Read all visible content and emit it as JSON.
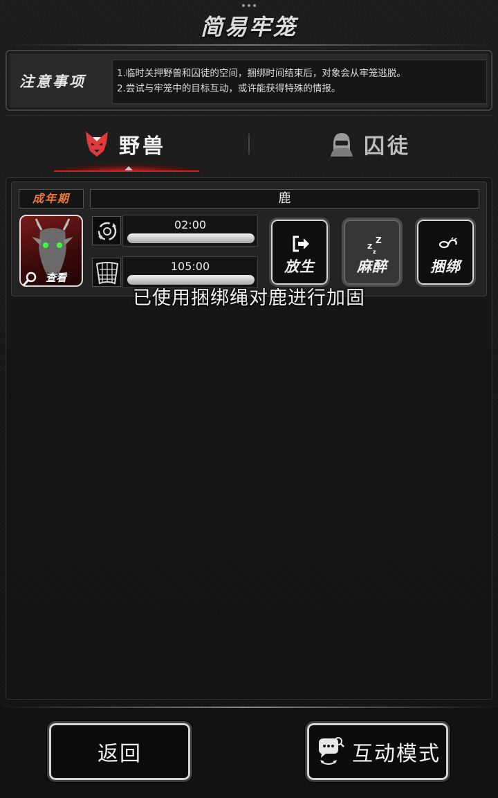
{
  "header": {
    "title": "简易牢笼"
  },
  "notice": {
    "label": "注意事项",
    "lines": [
      "1.临时关押野兽和囚徒的空间，捆绑时间结束后，对象会从牢笼逃脱。",
      "2.尝试与牢笼中的目标互动，或许能获得特殊的情报。"
    ]
  },
  "tabs": [
    {
      "label": "野兽",
      "icon": "wolf-icon",
      "active": true
    },
    {
      "label": "囚徒",
      "icon": "hooded-prisoner-icon",
      "active": false
    }
  ],
  "captive": {
    "stage": "成年期",
    "name": "鹿",
    "portrait_icon": "deer-portrait",
    "view_label": "查看",
    "stats": [
      {
        "icon": "cycle-icon",
        "time": "02:00",
        "progress": 1.0
      },
      {
        "icon": "net-icon",
        "time": "105:00",
        "progress": 1.0
      }
    ],
    "actions": [
      {
        "label": "放生",
        "icon": "exit-arrow-icon",
        "enabled": true
      },
      {
        "label": "麻醉",
        "icon": "sleep-z-icon",
        "enabled": false
      },
      {
        "label": "捆绑",
        "icon": "rope-icon",
        "enabled": true
      }
    ]
  },
  "toast": "已使用捆绑绳对鹿进行加固",
  "bottom": {
    "back_label": "返回",
    "interact_label": "互动模式",
    "interact_icon": "chat-magnifier-icon"
  },
  "colors": {
    "stage_tag": "#f07a3a",
    "tab_highlight": "#d02020"
  }
}
